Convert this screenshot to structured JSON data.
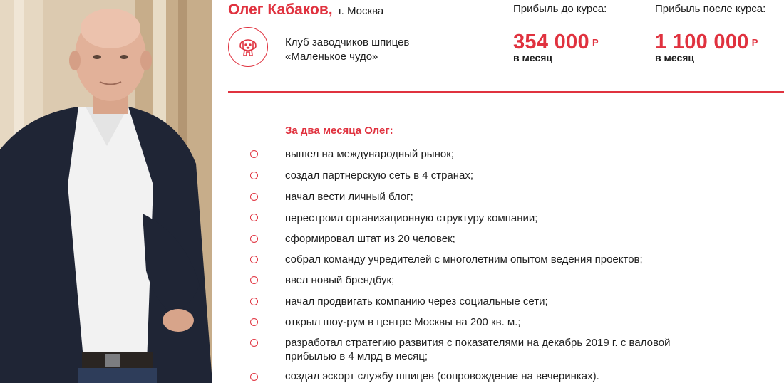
{
  "person": {
    "name": "Олег Кабаков,",
    "city": "г. Москва"
  },
  "club": {
    "icon": "dog-icon",
    "line1": "Клуб заводчиков шпицев",
    "line2": "«Маленькое чудо»"
  },
  "profit_before": {
    "label": "Прибыль до курса:",
    "amount": "354 000",
    "currency": "Р",
    "period": "в месяц"
  },
  "profit_after": {
    "label": "Прибыль после курса:",
    "amount": "1 100 000",
    "currency": "Р",
    "period": "в месяц"
  },
  "section_title": "За два месяца Олег:",
  "achievements": [
    "вышел на международный рынок;",
    "создал партнерскую сеть в 4 странах;",
    "начал вести личный блог;",
    "перестроил организационную структуру компании;",
    "сформировал штат из 20 человек;",
    "собрал команду учредителей с многолетним опытом ведения проектов;",
    "ввел новый брендбук;",
    "начал продвигать компанию через социальные сети;",
    "открыл шоу-рум в центре Москвы на 200 кв. м.;",
    "разработал стратегию развития с показателями на декабрь 2019 г. с валовой",
    "прибылью в 4 млрд   в месяц;",
    "создал эскорт службу шпицев (сопровождение на вечеринках)."
  ],
  "colors": {
    "accent": "#e0323f",
    "text": "#1e1e1e"
  }
}
